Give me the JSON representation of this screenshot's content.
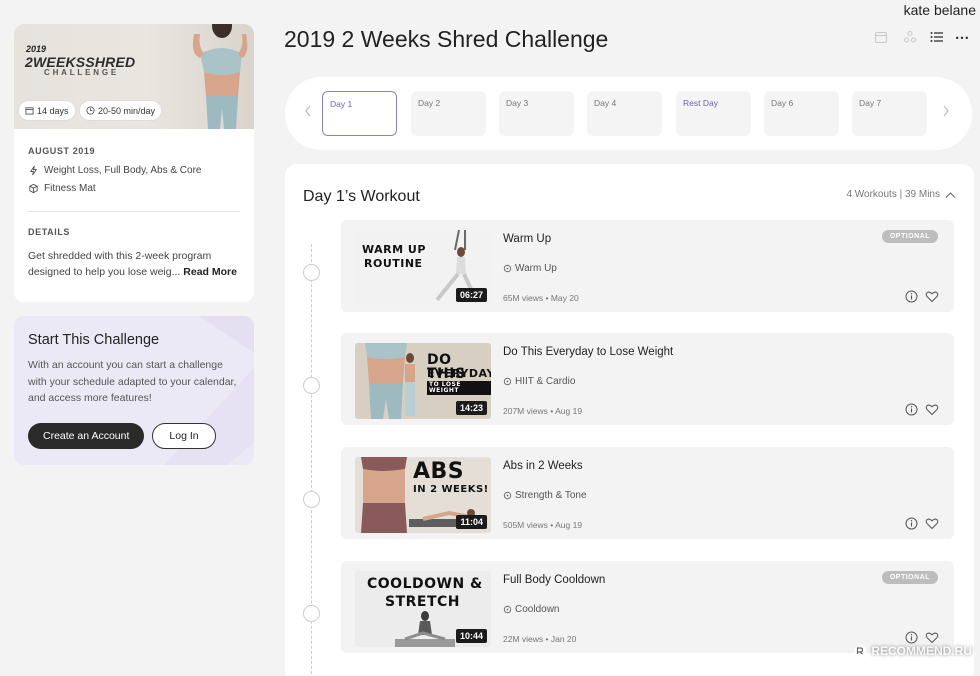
{
  "user": {
    "name": "kate belane"
  },
  "page": {
    "title": "2019 2 Weeks Shred Challenge"
  },
  "program": {
    "hero_year": "2019",
    "hero_title": "2WEEKSSHRED",
    "hero_subtitle": "CHALLENGE",
    "duration_pill": "14 days",
    "time_pill": "20-50 min/day",
    "date": "AUGUST 2019",
    "focus": "Weight Loss, Full Body, Abs & Core",
    "equipment": "Fitness Mat",
    "details_label": "DETAILS",
    "description": "Get shredded with this 2-week program designed to help you lose weig...",
    "read_more": "Read More"
  },
  "start": {
    "title": "Start This Challenge",
    "description": "With an account you can start a challenge with your schedule adapted to your calendar, and access more features!",
    "create_label": "Create an Account",
    "login_label": "Log In"
  },
  "days": [
    "Day 1",
    "Day 2",
    "Day 3",
    "Day 4",
    "Rest Day",
    "Day 6",
    "Day 7"
  ],
  "workout": {
    "title": "Day 1’s Workout",
    "meta": "4 Workouts | 39 Mins",
    "items": [
      {
        "title": "Warm Up",
        "category": "Warm Up",
        "meta": "65M views • May 20",
        "duration": "06:27",
        "optional": "OPTIONAL",
        "thumb_text": [
          "WARM UP",
          "ROUTINE"
        ]
      },
      {
        "title": "Do This Everyday to Lose Weight",
        "category": "HIIT & Cardio",
        "meta": "207M views • Aug 19",
        "duration": "14:23",
        "thumb_text": [
          "DO THIS",
          "EVERYDAY",
          "TO LOSE WEIGHT"
        ]
      },
      {
        "title": "Abs in 2 Weeks",
        "category": "Strength & Tone",
        "meta": "505M views • Aug 19",
        "duration": "11:04",
        "thumb_text": [
          "ABS",
          "IN 2 WEEKS!"
        ]
      },
      {
        "title": "Full Body Cooldown",
        "category": "Cooldown",
        "meta": "22M views • Jan 20",
        "duration": "10:44",
        "optional": "OPTIONAL",
        "thumb_text": [
          "COOLDOWN &",
          "STRETCH"
        ]
      }
    ]
  },
  "watermark": "RECOMMEND.RU",
  "colors": {
    "accent": "#6b63b5",
    "dark_button": "#2a2a2a",
    "start_card_bg": "#ece9f6"
  }
}
